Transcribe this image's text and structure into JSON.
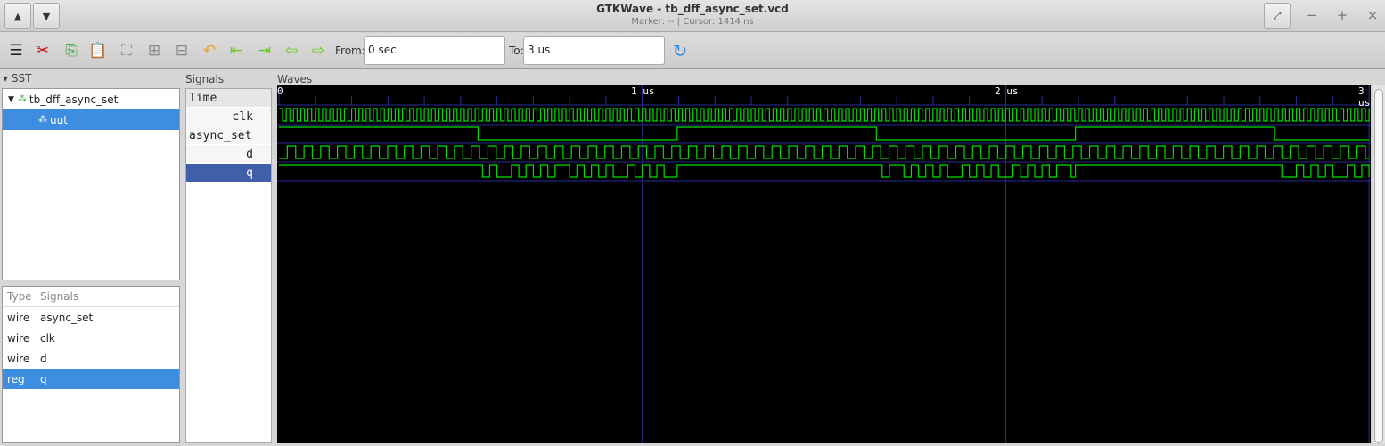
{
  "window": {
    "title": "GTKWave - tb_dff_async_set.vcd",
    "subtitle": "Marker: --  |  Cursor: 1414 ns"
  },
  "toolbar": {
    "from_label": "From:",
    "from_value": "0 sec",
    "to_label": "To:",
    "to_value": "3 us"
  },
  "sst": {
    "label": "SST",
    "tree": [
      {
        "label": "tb_dff_async_set"
      },
      {
        "label": "uut"
      }
    ],
    "columns": [
      "Type",
      "Signals"
    ],
    "signals": [
      {
        "type": "wire",
        "name": "async_set"
      },
      {
        "type": "wire",
        "name": "clk"
      },
      {
        "type": "wire",
        "name": "d"
      },
      {
        "type": "reg",
        "name": "q"
      }
    ]
  },
  "signals_panel": {
    "label": "Signals",
    "header": "Time",
    "rows": [
      "clk",
      "async_set",
      "d",
      "q"
    ]
  },
  "waves_panel": {
    "label": "Waves",
    "ruler": [
      "0",
      "1 us",
      "2 us",
      "3 us"
    ]
  },
  "waveform": {
    "range_ns": [
      0,
      3000
    ],
    "clk_period_ns": 20,
    "d_half_period_ns": 23,
    "async_set_toggle_ns": 548,
    "color": "#00e000",
    "grid_color": "#2a2a9a"
  }
}
